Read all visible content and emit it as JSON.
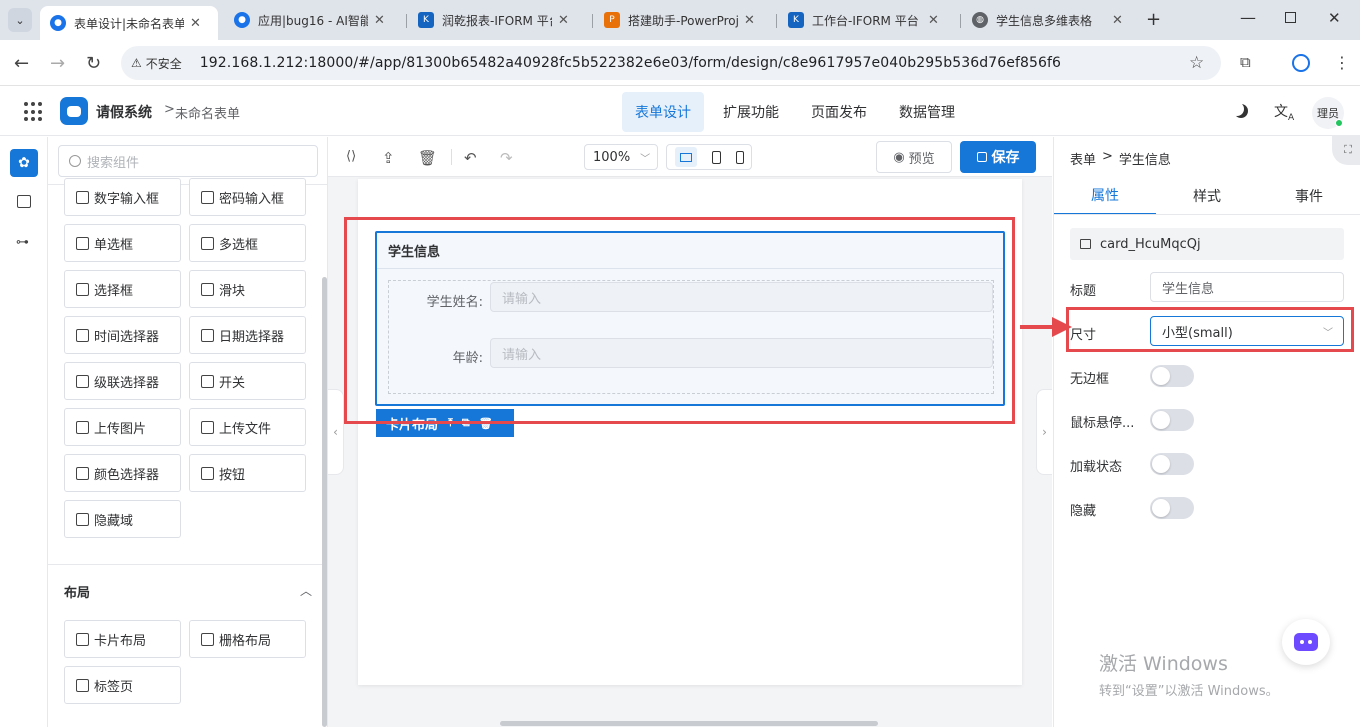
{
  "browser": {
    "tabs": [
      {
        "title": "表单设计|未命名表单",
        "active": true,
        "favicon_color": "#1a73e8"
      },
      {
        "title": "应用|bug16 - AI智能",
        "active": false,
        "favicon_color": "#1a73e8"
      },
      {
        "title": "润乾报表-IFORM 平台",
        "active": false,
        "favicon_color": "#1565c0"
      },
      {
        "title": "搭建助手-PowerProj",
        "active": false,
        "favicon_color": "#e8710a"
      },
      {
        "title": "工作台-IFORM 平台",
        "active": false,
        "favicon_color": "#1565c0"
      },
      {
        "title": "学生信息多维表格",
        "active": false,
        "favicon_color": "#5f6368"
      }
    ],
    "security_label": "不安全",
    "url": "192.168.1.212:18000/#/app/81300b65482a40928fc5b522382e6e03/form/design/c8e9617957e040b295b536d76ef856f6"
  },
  "header": {
    "app_name": "请假系统",
    "breadcrumb_separator": ">",
    "form_name": "未命名表单",
    "nav": [
      "表单设计",
      "扩展功能",
      "页面发布",
      "数据管理"
    ],
    "active_nav": 0,
    "avatar_text": "理员"
  },
  "components": {
    "search_placeholder": "搜索组件",
    "items": [
      {
        "label": "数字输入框",
        "icon": "number-input-icon"
      },
      {
        "label": "密码输入框",
        "icon": "lock-icon"
      },
      {
        "label": "单选框",
        "icon": "radio-icon"
      },
      {
        "label": "多选框",
        "icon": "checkbox-icon"
      },
      {
        "label": "选择框",
        "icon": "select-icon"
      },
      {
        "label": "滑块",
        "icon": "slider-icon"
      },
      {
        "label": "时间选择器",
        "icon": "clock-icon"
      },
      {
        "label": "日期选择器",
        "icon": "calendar-icon"
      },
      {
        "label": "级联选择器",
        "icon": "cascader-icon"
      },
      {
        "label": "开关",
        "icon": "toggle-icon"
      },
      {
        "label": "上传图片",
        "icon": "image-icon"
      },
      {
        "label": "上传文件",
        "icon": "upload-icon"
      },
      {
        "label": "颜色选择器",
        "icon": "palette-icon"
      },
      {
        "label": "按钮",
        "icon": "button-icon"
      },
      {
        "label": "隐藏域",
        "icon": "eye-off-icon"
      }
    ],
    "layout_section_title": "布局",
    "layout_items": [
      {
        "label": "卡片布局",
        "icon": "card-icon"
      },
      {
        "label": "栅格布局",
        "icon": "grid-icon"
      },
      {
        "label": "标签页",
        "icon": "tabs-icon"
      }
    ]
  },
  "toolbar": {
    "zoom": "100%",
    "preview_label": "预览",
    "save_label": "保存"
  },
  "canvas": {
    "card_title": "学生信息",
    "fields": [
      {
        "label": "学生姓名:",
        "placeholder": "请输入"
      },
      {
        "label": "年龄:",
        "placeholder": "请输入"
      }
    ],
    "selection_label": "卡片布局"
  },
  "right_panel": {
    "breadcrumb_root": "表单",
    "breadcrumb_sep": ">",
    "breadcrumb_current": "学生信息",
    "tabs": [
      "属性",
      "样式",
      "事件"
    ],
    "active_tab": 0,
    "component_id": "card_HcuMqcQj",
    "props": {
      "title_label": "标题",
      "title_value": "学生信息",
      "size_label": "尺寸",
      "size_value": "小型(small)",
      "borderless_label": "无边框",
      "hover_label": "鼠标悬停...",
      "loading_label": "加载状态",
      "hidden_label": "隐藏"
    }
  },
  "watermark": {
    "line1": "激活 Windows",
    "line2": "转到“设置”以激活 Windows。"
  },
  "colors": {
    "primary": "#1677d9",
    "annotation_red": "#e5484d"
  }
}
